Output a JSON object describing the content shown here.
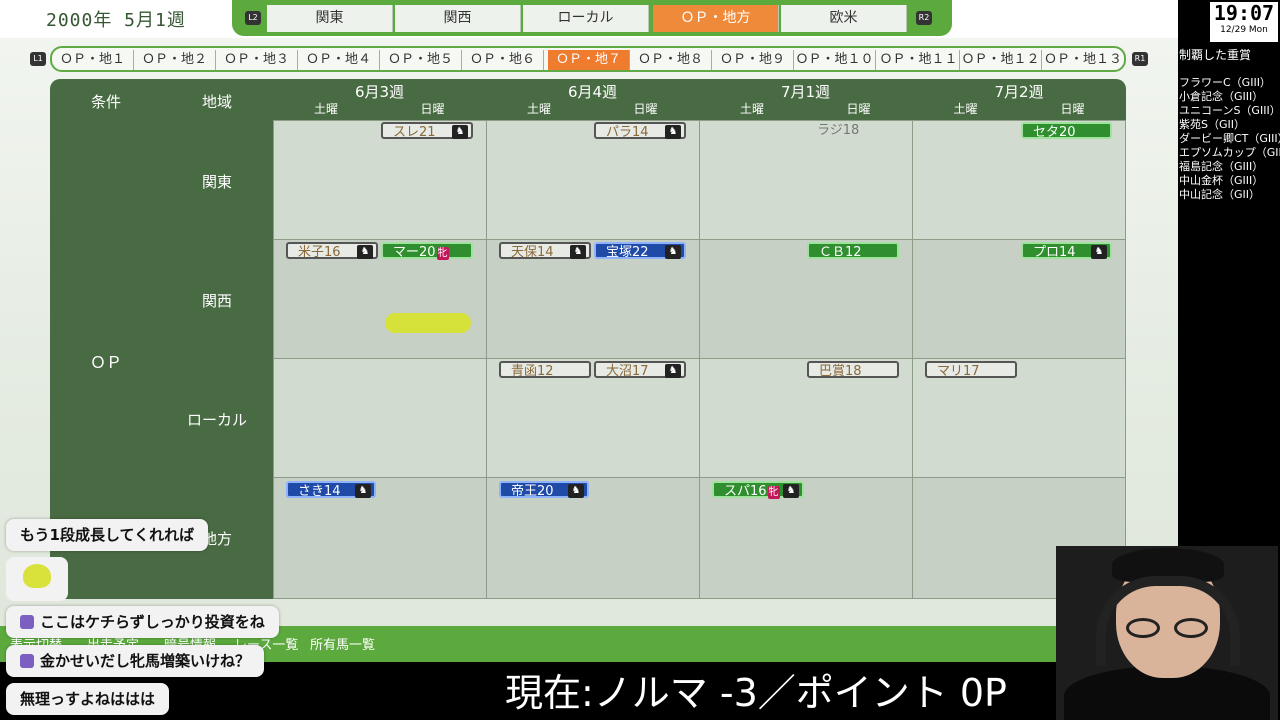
{
  "header": {
    "date": "2000年 5月1週",
    "shoulder_left": "L2",
    "shoulder_right": "R2",
    "tabs": [
      {
        "label": "関東"
      },
      {
        "label": "関西"
      },
      {
        "label": "ローカル"
      },
      {
        "label": "ＯＰ・地方"
      },
      {
        "label": "欧米"
      }
    ],
    "active_tab": "ＯＰ・地方"
  },
  "subtabs": {
    "shoulder_left": "L1",
    "shoulder_right": "R1",
    "items": [
      "ＯＰ・地１",
      "ＯＰ・地２",
      "ＯＰ・地３",
      "ＯＰ・地４",
      "ＯＰ・地５",
      "ＯＰ・地６",
      "ＯＰ・地７",
      "ＯＰ・地８",
      "ＯＰ・地９",
      "ＯＰ・地１０",
      "ＯＰ・地１１",
      "ＯＰ・地１２",
      "ＯＰ・地１３"
    ],
    "active": "ＯＰ・地７"
  },
  "grid": {
    "col_condition": "条件",
    "col_region": "地域",
    "condition": "ＯＰ",
    "weeks": [
      {
        "label": "6月3週",
        "sat": "土曜",
        "sun": "日曜"
      },
      {
        "label": "6月4週",
        "sat": "土曜",
        "sun": "日曜"
      },
      {
        "label": "7月1週",
        "sat": "土曜",
        "sun": "日曜"
      },
      {
        "label": "7月2週",
        "sat": "土曜",
        "sun": "日曜"
      }
    ],
    "regions": [
      "関東",
      "関西",
      "ローカル",
      "地方"
    ],
    "races": [
      {
        "name": "スレ21",
        "style": "gray",
        "icon": "horse-icon"
      },
      {
        "name": "パラ14",
        "style": "gray",
        "icon": "horse-icon"
      },
      {
        "name": "ラジ18",
        "style": "plain"
      },
      {
        "name": "セタ20",
        "style": "green"
      },
      {
        "name": "米子16",
        "style": "gray",
        "icon": "horse-icon"
      },
      {
        "name": "マー20",
        "style": "green",
        "tag": "牝"
      },
      {
        "name": "天保14",
        "style": "gray",
        "icon": "horse-icon"
      },
      {
        "name": "宝塚22",
        "style": "blue",
        "icon": "horse-icon"
      },
      {
        "name": "ＣＢ12",
        "style": "green"
      },
      {
        "name": "プロ14",
        "style": "green",
        "icon": "horse-icon"
      },
      {
        "name": "青函12",
        "style": "gray"
      },
      {
        "name": "大沼17",
        "style": "gray",
        "icon": "horse-icon"
      },
      {
        "name": "巴賞18",
        "style": "gray"
      },
      {
        "name": "マリ17",
        "style": "gray"
      },
      {
        "name": "さき14",
        "style": "blue",
        "icon": "horse-icon"
      },
      {
        "name": "帝王20",
        "style": "blue",
        "icon": "horse-icon"
      },
      {
        "name": "スパ16",
        "style": "green",
        "tag": "牝",
        "icon": "horse-icon"
      }
    ]
  },
  "bottom_nav": [
    "表示切替",
    "出走予定",
    "暗号情報",
    "レース一覧",
    "所有馬一覧"
  ],
  "overlay": {
    "clock_time": "19:07",
    "clock_date": "12/29 Mon",
    "list_title": "制覇した重賞",
    "list": [
      "フラワーC（GIII）",
      "小倉記念（GIII）",
      "ユニコーンS（GIII）",
      "紫苑S（GII）",
      "ダービー卿CT（GIII）",
      "エプソムカップ（GIII）",
      "福島記念（GIII）",
      "中山金杯（GIII）",
      "中山記念（GII）"
    ],
    "quota": "現在:ノルマ -3／ポイント 0P",
    "chat": [
      "もう1段成長してくれれば",
      "ここはケチらずしっかり投資をね",
      "金かせいだし牝馬増築いけね？",
      "無理っすよねははは"
    ]
  },
  "colors": {
    "accent_green": "#5caa3e",
    "active_orange": "#ef7b2f",
    "grid_dark": "#496b43"
  }
}
